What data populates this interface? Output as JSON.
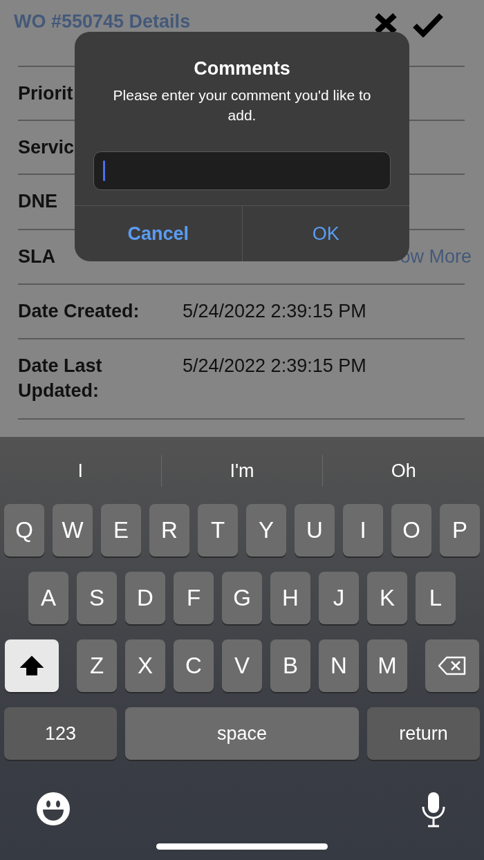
{
  "header": {
    "title": "WO #550745 Details"
  },
  "details": [
    {
      "label": "Priorit"
    },
    {
      "label": "Servic"
    },
    {
      "label": "DNE"
    },
    {
      "label": "SLA",
      "link": "ow More"
    },
    {
      "label": "Date Created:",
      "value": "5/24/2022 2:39:15 PM"
    },
    {
      "label": "Date Last Updated:",
      "value": "5/24/2022 2:39:15 PM"
    }
  ],
  "dialog": {
    "title": "Comments",
    "message": "Please enter your comment you'd like to add.",
    "input": {
      "focused": true
    },
    "buttons": [
      {
        "label": "Cancel",
        "preferred": true
      },
      {
        "label": "OK",
        "preferred": false
      }
    ]
  },
  "keyboard": {
    "suggestions": [
      "I",
      "I'm",
      "Oh"
    ],
    "key_rows": [
      {
        "keys": [
          {
            "kind": "letter",
            "label": "Q"
          },
          {
            "kind": "letter",
            "label": "W"
          },
          {
            "kind": "letter",
            "label": "E"
          },
          {
            "kind": "letter",
            "label": "R"
          },
          {
            "kind": "letter",
            "label": "T"
          },
          {
            "kind": "letter",
            "label": "Y"
          },
          {
            "kind": "letter",
            "label": "U"
          },
          {
            "kind": "letter",
            "label": "I"
          },
          {
            "kind": "letter",
            "label": "O"
          },
          {
            "kind": "letter",
            "label": "P"
          }
        ]
      },
      {
        "keys": [
          {
            "kind": "letter",
            "label": "A"
          },
          {
            "kind": "letter",
            "label": "S"
          },
          {
            "kind": "letter",
            "label": "D"
          },
          {
            "kind": "letter",
            "label": "F"
          },
          {
            "kind": "letter",
            "label": "G"
          },
          {
            "kind": "letter",
            "label": "H"
          },
          {
            "kind": "letter",
            "label": "J"
          },
          {
            "kind": "letter",
            "label": "K"
          },
          {
            "kind": "letter",
            "label": "L"
          }
        ]
      },
      {
        "keys": [
          {
            "kind": "shift",
            "on": true
          },
          {
            "kind": "letter",
            "label": "Z"
          },
          {
            "kind": "letter",
            "label": "X"
          },
          {
            "kind": "letter",
            "label": "C"
          },
          {
            "kind": "letter",
            "label": "V"
          },
          {
            "kind": "letter",
            "label": "B"
          },
          {
            "kind": "letter",
            "label": "N"
          },
          {
            "kind": "letter",
            "label": "M"
          },
          {
            "kind": "delete"
          }
        ]
      },
      {
        "keys": [
          {
            "kind": "function",
            "label": "123"
          },
          {
            "kind": "space",
            "label": "space"
          },
          {
            "kind": "function",
            "label": "return"
          }
        ]
      }
    ]
  }
}
